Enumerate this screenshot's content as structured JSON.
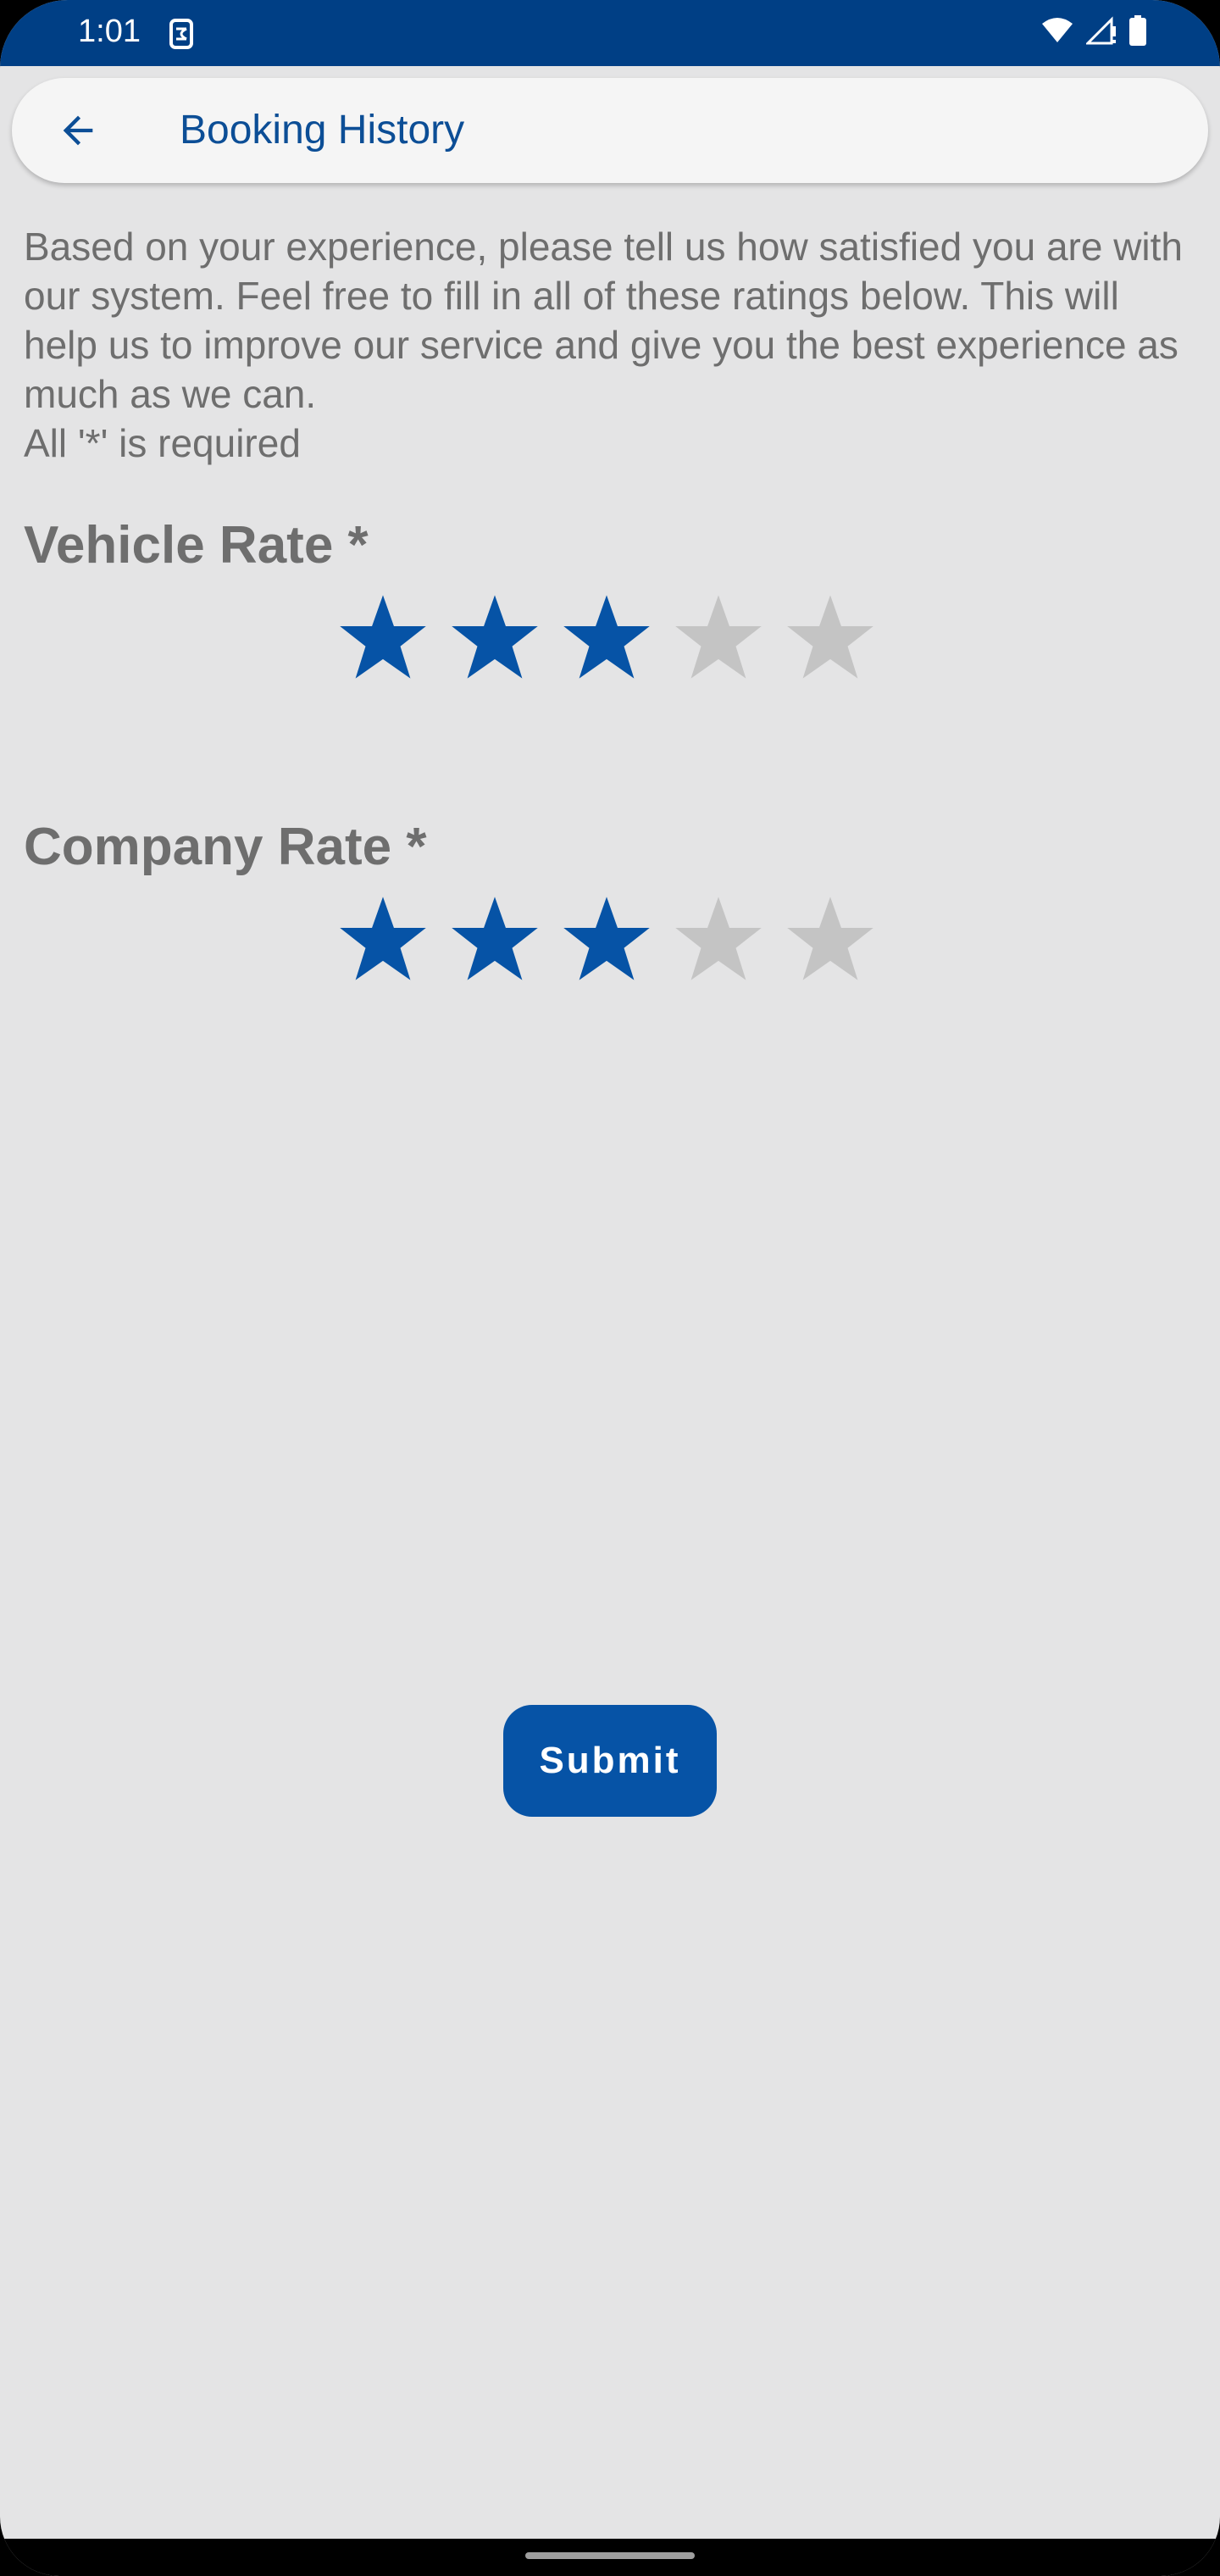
{
  "status_bar": {
    "time": "1:01",
    "icons": [
      "sim-toolkit-icon",
      "wifi-icon",
      "signal-icon",
      "battery-icon"
    ],
    "background": "#003f85"
  },
  "app_bar": {
    "title": "Booking History",
    "back_icon": "arrow-back-icon",
    "title_color": "#0c4e96"
  },
  "intro": {
    "text": "Based on your experience, please tell us how satisfied you are with our system. Feel free to fill in all of these ratings below. This will help us to improve our service and give you the best experience as much as we can.\n All '*' is required"
  },
  "ratings": [
    {
      "label": "Vehicle Rate *",
      "value": 3,
      "max": 5
    },
    {
      "label": "Company Rate *",
      "value": 3,
      "max": 5
    }
  ],
  "colors": {
    "star_filled": "#0653a6",
    "star_empty": "#c4c4c4",
    "accent": "#0653a6",
    "text_muted": "#6e6e6e"
  },
  "submit": {
    "label": "Submit"
  }
}
